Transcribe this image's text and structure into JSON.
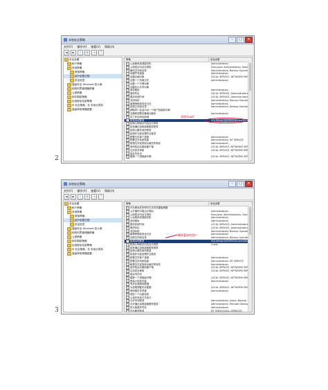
{
  "screens": [
    {
      "window_title": "本地安全策略",
      "menu": [
        "文件(F)",
        "操作(A)",
        "查看(V)",
        "帮助(H)"
      ],
      "tree": [
        "安全设置",
        "帐户策略",
        "本地策略",
        "审核策略",
        "用户权限分配",
        "安全选项",
        "高级安全 Windows 防火墙",
        "网络列表管理器策略",
        "公钥策略",
        "软件限制策略",
        "应用程序控制策略",
        "IP 安全策略，在 本地计算机",
        "高级审核策略配置"
      ],
      "columns": {
        "policy": "策略",
        "setting": "安全设置"
      },
      "rows": [
        {
          "policy": "从远程系统强制关机",
          "setting": "Administrators"
        },
        {
          "policy": "从网络访问此计算机",
          "setting": "Everyone, Administrators, Backup"
        },
        {
          "policy": "备份文件和目录",
          "setting": "Administrators, Backup Operators"
        },
        {
          "policy": "创建符号链接",
          "setting": "Administrators"
        },
        {
          "policy": "创建全局对象",
          "setting": "LOCAL SERVICE, NETWORK SERVICE"
        },
        {
          "policy": "创建一个页面文件",
          "setting": "Administrators"
        },
        {
          "policy": "创建一个令牌对象",
          "setting": ""
        },
        {
          "policy": "创建永久共享对象",
          "setting": ""
        },
        {
          "policy": "调试程序",
          "setting": "Administrators"
        },
        {
          "policy": "更改时区",
          "setting": "LOCAL SERVICE, Administrators"
        },
        {
          "policy": "更改系统时间",
          "setting": "LOCAL SERVICE, Administrators"
        },
        {
          "policy": "关闭系统",
          "setting": "Administrators, Backup Operators"
        },
        {
          "policy": "管理审核和安全日志",
          "setting": "Administrators"
        },
        {
          "policy": "还原文件和目录",
          "setting": "Administrators, Backup Operators"
        },
        {
          "policy": "获取同一会话中另一个用户的模拟令牌",
          "setting": ""
        },
        {
          "policy": "加载和卸载设备驱动程序",
          "setting": "Administrators"
        },
        {
          "policy": "将工作站添加到域",
          "setting": ""
        },
        {
          "policy": "拒绝本地登录",
          "setting": "SQLServer2005MSSQLUser$WIN"
        },
        {
          "policy": "拒绝从网络访问这台计算机",
          "setting": ""
        },
        {
          "policy": "拒绝通过远程桌面服务登录",
          "setting": ""
        },
        {
          "policy": "拒绝以服务身份登录",
          "setting": ""
        },
        {
          "policy": "拒绝作为批处理作业登录",
          "setting": ""
        },
        {
          "policy": "配置文件单个进程",
          "setting": "Administrators"
        },
        {
          "policy": "配置文件系统性能",
          "setting": "Administrators, NT SERVICE"
        },
        {
          "policy": "取得文件或其他对象的所有权",
          "setting": "Administrators"
        },
        {
          "policy": "身份验证后模拟客户端",
          "setting": "LOCAL SERVICE, NETWORK SERVICE"
        },
        {
          "policy": "生成安全审核",
          "setting": "LOCAL SERVICE, NETWORK SERVICE"
        },
        {
          "policy": "锁定内存页",
          "setting": ""
        },
        {
          "policy": "替换一个进程级令牌",
          "setting": "LOCAL SERVICE, NETWORK SERVICE"
        }
      ],
      "highlight_index": 17,
      "annotation": "添加Guest"
    },
    {
      "window_title": "本地安全策略",
      "menu": [
        "文件(F)",
        "操作(A)",
        "查看(V)",
        "帮助(H)"
      ],
      "tree": [
        "安全设置",
        "帐户策略",
        "本地策略",
        "审核策略",
        "用户权限分配",
        "安全选项",
        "高级安全 Windows 防火墙",
        "网络列表管理器策略",
        "公钥策略",
        "软件限制策略",
        "应用程序控制策略",
        "IP 安全策略，在 本地计算机",
        "高级审核策略配置"
      ],
      "columns": {
        "policy": "策略",
        "setting": "安全设置"
      },
      "rows": [
        {
          "policy": "作为受信任的呼叫方访问凭据管理器",
          "setting": ""
        },
        {
          "policy": "从扩展坞中取出计算机",
          "setting": "Administrators"
        },
        {
          "policy": "从网络访问此计算机",
          "setting": "Everyone, Administrators, Users"
        },
        {
          "policy": "从远程系统强制关机",
          "setting": "Administrators"
        },
        {
          "policy": "调试程序",
          "setting": "Administrators"
        },
        {
          "policy": "更改系统时间",
          "setting": "LOCAL SERVICE, Administrators"
        },
        {
          "policy": "更改时区",
          "setting": "LOCAL SERVICE, Administrators"
        },
        {
          "policy": "关闭系统",
          "setting": "Administrators, Backup Operators"
        },
        {
          "policy": "管理审核和安全日志",
          "setting": "Administrators"
        },
        {
          "policy": "还原文件和目录",
          "setting": "Administrators, Backup Operators"
        },
        {
          "policy": "拒绝本地登录",
          "setting": "SQLServer2005MSSQLUser$WIN"
        },
        {
          "policy": "拒绝从网络访问这台计算机",
          "setting": "Guest"
        },
        {
          "policy": "拒绝通过远程桌面服务登录",
          "setting": ""
        },
        {
          "policy": "拒绝以服务身份登录",
          "setting": ""
        },
        {
          "policy": "拒绝作为批处理作业登录",
          "setting": ""
        },
        {
          "policy": "配置文件单个进程",
          "setting": "Administrators"
        },
        {
          "policy": "配置文件系统性能",
          "setting": "Administrators, NT SERVICE"
        },
        {
          "policy": "取得文件或其他对象的所有权",
          "setting": "Administrators"
        },
        {
          "policy": "身份验证后模拟客户端",
          "setting": "LOCAL SERVICE, NETWORK SERVICE"
        },
        {
          "policy": "生成安全审核",
          "setting": "LOCAL SERVICE, NETWORK SERVICE"
        },
        {
          "policy": "锁定内存页",
          "setting": ""
        },
        {
          "policy": "替换一个进程级令牌",
          "setting": "LOCAL SERVICE, NETWORK SERVICE"
        },
        {
          "policy": "提高计划优先级",
          "setting": "Administrators"
        },
        {
          "policy": "同步目录服务数据",
          "setting": ""
        },
        {
          "policy": "为进程调整内存配额",
          "setting": "LOCAL SERVICE, NETWORK SERVICE"
        },
        {
          "policy": "修改固件环境值",
          "setting": "Administrators"
        },
        {
          "policy": "修改一个对象标签",
          "setting": ""
        },
        {
          "policy": "以操作系统方式执行",
          "setting": ""
        },
        {
          "policy": "允许本地登录",
          "setting": "Administrators, Users, Backup"
        },
        {
          "policy": "允许通过远程桌面服务登录",
          "setting": "Administrators, Remote Desktop"
        },
        {
          "policy": "执行卷维护任务",
          "setting": "Administrators"
        },
        {
          "policy": "作为服务登录",
          "setting": "NT SERVICE\\ALL SERVICES"
        }
      ],
      "highlight_index": 10,
      "annotation": "删除某些的用户"
    }
  ],
  "page_numbers": [
    "2",
    "3"
  ],
  "toolbar_icons": [
    "back-icon",
    "forward-icon",
    "up-icon",
    "properties-icon",
    "export-icon",
    "help-icon"
  ]
}
